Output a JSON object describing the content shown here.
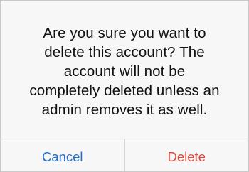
{
  "dialog": {
    "message_lines": [
      "Are you sure you want to",
      "delete this account? The",
      "account will not be",
      "completely deleted unless an",
      "admin removes it as well."
    ],
    "cancel_label": "Cancel",
    "delete_label": "Delete"
  },
  "colors": {
    "cancel": "#1f6fd1",
    "delete": "#e0453a",
    "background": "#f7f7f7",
    "divider": "#d3d3d3"
  }
}
